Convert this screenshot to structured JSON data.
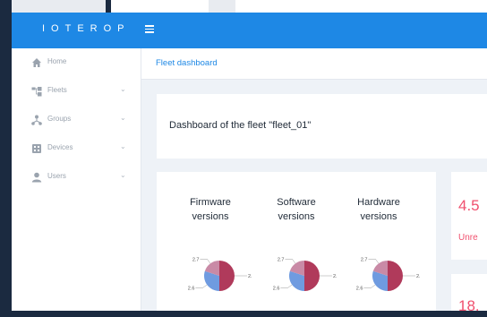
{
  "header": {
    "brand": "IOTEROP"
  },
  "sidebar": {
    "items": [
      {
        "label": "Home",
        "has_children": false
      },
      {
        "label": "Fleets",
        "has_children": true
      },
      {
        "label": "Groups",
        "has_children": true
      },
      {
        "label": "Devices",
        "has_children": true
      },
      {
        "label": "Users",
        "has_children": true
      }
    ],
    "chevron": "⌄"
  },
  "breadcrumb": {
    "current": "Fleet dashboard"
  },
  "main": {
    "title": "Dashboard of the fleet \"fleet_01\"",
    "versions": [
      {
        "title": "Firmware versions",
        "line1": "Firmware",
        "line2": "versions",
        "slices": [
          {
            "label": "2.5",
            "value": 50,
            "color": "#b03a5b"
          },
          {
            "label": "2.6",
            "value": 30,
            "color": "#6f9be0"
          },
          {
            "label": "2.7",
            "value": 20,
            "color": "#c98aa6"
          }
        ]
      },
      {
        "title": "Software versions",
        "line1": "Software",
        "line2": "versions",
        "slices": [
          {
            "label": "2.5",
            "value": 50,
            "color": "#b03a5b"
          },
          {
            "label": "2.6",
            "value": 30,
            "color": "#6f9be0"
          },
          {
            "label": "2.7",
            "value": 20,
            "color": "#c98aa6"
          }
        ]
      },
      {
        "title": "Hardware versions",
        "line1": "Hardware",
        "line2": "versions",
        "slices": [
          {
            "label": "2.5",
            "value": 50,
            "color": "#b03a5b"
          },
          {
            "label": "2.6",
            "value": 30,
            "color": "#6f9be0"
          },
          {
            "label": "2.7",
            "value": 20,
            "color": "#c98aa6"
          }
        ]
      }
    ],
    "stats": [
      {
        "value": "4.5",
        "label": "Unre"
      },
      {
        "value": "18.",
        "label": ""
      }
    ]
  },
  "colors": {
    "primary": "#1e88e5",
    "accent": "#f0506e",
    "sidebar_text": "#9aa3ae"
  }
}
